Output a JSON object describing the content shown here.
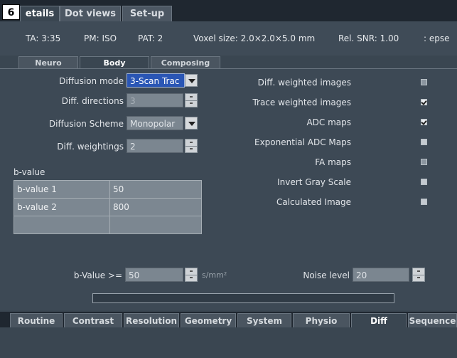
{
  "badge": "6",
  "top_tabs": [
    "etails",
    "Dot views",
    "Set-up"
  ],
  "info": {
    "ta": "TA: 3:35",
    "pm": "PM: ISO",
    "pat": "PAT: 2",
    "voxel": "Voxel size: 2.0×2.0×5.0 mm",
    "snr": "Rel. SNR: 1.00",
    "extra": ": epse"
  },
  "sub_tabs": [
    "Neuro",
    "Body",
    "Composing"
  ],
  "left": {
    "diffusion_mode_label": "Diffusion mode",
    "diffusion_mode_value": "3-Scan Trac",
    "diff_directions_label": "Diff. directions",
    "diff_directions_value": "3",
    "diffusion_scheme_label": "Diffusion Scheme",
    "diffusion_scheme_value": "Monopolar",
    "diff_weightings_label": "Diff. weightings",
    "diff_weightings_value": "2",
    "bvalue_header": "b-value",
    "bvalue_rows": [
      {
        "name": "b-value 1",
        "value": "50"
      },
      {
        "name": "b-value 2",
        "value": "800"
      },
      {
        "name": "",
        "value": ""
      }
    ]
  },
  "right": {
    "items": [
      {
        "label": "Diff. weighted images",
        "checked": false,
        "enabled": false
      },
      {
        "label": "Trace weighted images",
        "checked": true,
        "enabled": true
      },
      {
        "label": "ADC maps",
        "checked": true,
        "enabled": true
      },
      {
        "label": "Exponential ADC Maps",
        "checked": false,
        "enabled": true
      },
      {
        "label": "FA maps",
        "checked": false,
        "enabled": false
      },
      {
        "label": "Invert Gray Scale",
        "checked": false,
        "enabled": true
      },
      {
        "label": "Calculated Image",
        "checked": false,
        "enabled": true
      }
    ]
  },
  "bottom_controls": {
    "bvalue_ge_label": "b-Value >=",
    "bvalue_ge_value": "50",
    "bvalue_unit": "s/mm²",
    "noise_label": "Noise level",
    "noise_value": "20"
  },
  "bottom_tabs": [
    "Routine",
    "Contrast",
    "Resolution",
    "Geometry",
    "System",
    "Physio",
    "Diff",
    "Sequence"
  ]
}
